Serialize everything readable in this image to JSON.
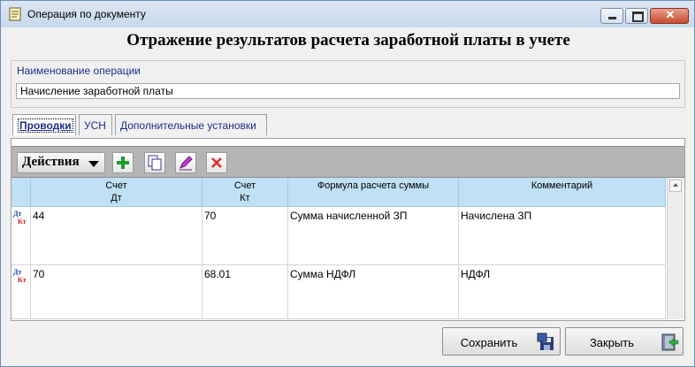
{
  "window": {
    "title": "Операция по документу",
    "heading": "Отражение результатов расчета заработной платы в учете"
  },
  "operation": {
    "label": "Наименование операции",
    "value": "Начисление заработной платы"
  },
  "tabs": [
    {
      "label": "Проводки",
      "active": true
    },
    {
      "label": "УСН",
      "active": false
    },
    {
      "label": "Дополнительные установки",
      "active": false
    }
  ],
  "toolbar": {
    "actions_label": "Действия"
  },
  "table": {
    "headers": {
      "debit_line1": "Счет",
      "debit_line2": "Дт",
      "credit_line1": "Счет",
      "credit_line2": "Кт",
      "formula": "Формула расчета суммы",
      "comment": "Комментарий"
    },
    "row_icon": {
      "dt": "Дт",
      "kt": "Кт"
    },
    "rows": [
      {
        "debit": "44",
        "credit": "70",
        "formula": "Сумма начисленной ЗП",
        "comment": "Начислена ЗП"
      },
      {
        "debit": "70",
        "credit": "68.01",
        "formula": "Сумма НДФЛ",
        "comment": "НДФЛ"
      }
    ]
  },
  "buttons": {
    "save": "Сохранить",
    "close": "Закрыть"
  }
}
